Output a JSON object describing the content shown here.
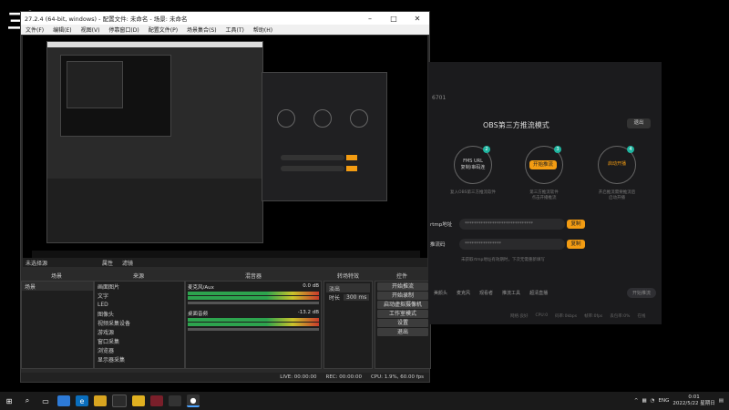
{
  "logo_text": "三烟",
  "obs": {
    "title": "27.2.4 (64-bit, windows) - 配置文件: 未命名 - 场景: 未命名",
    "menu": [
      "文件(F)",
      "编辑(E)",
      "视图(V)",
      "停靠窗口(D)",
      "配置文件(P)",
      "场景集合(S)",
      "工具(T)",
      "帮助(H)"
    ],
    "no_source": "未选择源",
    "props_label": "属性",
    "filters_label": "滤镜",
    "docks": {
      "scenes": "场景",
      "sources": "来源",
      "mixer": "混音器",
      "transitions": "转场特效",
      "controls": "控件"
    },
    "scene_item": "场景",
    "sources": [
      "画面图片",
      "文字",
      "LED",
      "图像头",
      "视频采集设备",
      "游戏源",
      "窗口采集",
      "浏览器",
      "显示器采集",
      "下载",
      "下载器"
    ],
    "mixer": [
      {
        "name": "麦克风/Aux",
        "db": "0.0 dB"
      },
      {
        "name": "桌面音频",
        "db": "-13.2 dB"
      }
    ],
    "transition": {
      "type": "淡出",
      "duration_label": "时长",
      "duration": "300 ms"
    },
    "controls": [
      "开始推流",
      "开始录制",
      "启动虚拟摄像机",
      "工作室模式",
      "设置",
      "退出"
    ],
    "status": {
      "live": "LIVE: 00:00:00",
      "rec": "REC: 00:00:00",
      "cpu": "CPU: 1.9%, 60.00 fps"
    }
  },
  "panel": {
    "id_text": "6701",
    "mode_title": "OBS第三方推流模式",
    "close_button": "退出",
    "steps": [
      {
        "num": "2",
        "label": "FMS URL\n复制/串码连"
      },
      {
        "num": "3",
        "label": "开始推流"
      },
      {
        "num": "4",
        "label": "启动开播"
      }
    ],
    "step_desc": [
      "复入OBS第三方推流软件",
      "第三方推流软件\n点击开播推流",
      "开启推流需要推流后\n启动开播"
    ],
    "rtmp_label": "rtmp地址",
    "rtmp_value": "******************************",
    "key_label": "推流码",
    "key_value": "****************",
    "copy_label": "复制",
    "note": "未获取rtmp地址有效期时，下次无需重新填写",
    "tools": [
      "美颜头",
      "麦克风",
      "观看者",
      "推流工具",
      "超清直播"
    ],
    "start_button": "开始推流",
    "status_items": [
      "网络:良好",
      "CPU:0",
      "码率:0kbps",
      "帧率:0fps",
      "丢包率:0%",
      "在线"
    ]
  },
  "taskbar": {
    "time": "0:01",
    "date": "2022/5/22 星期日",
    "lang": "ENG"
  }
}
